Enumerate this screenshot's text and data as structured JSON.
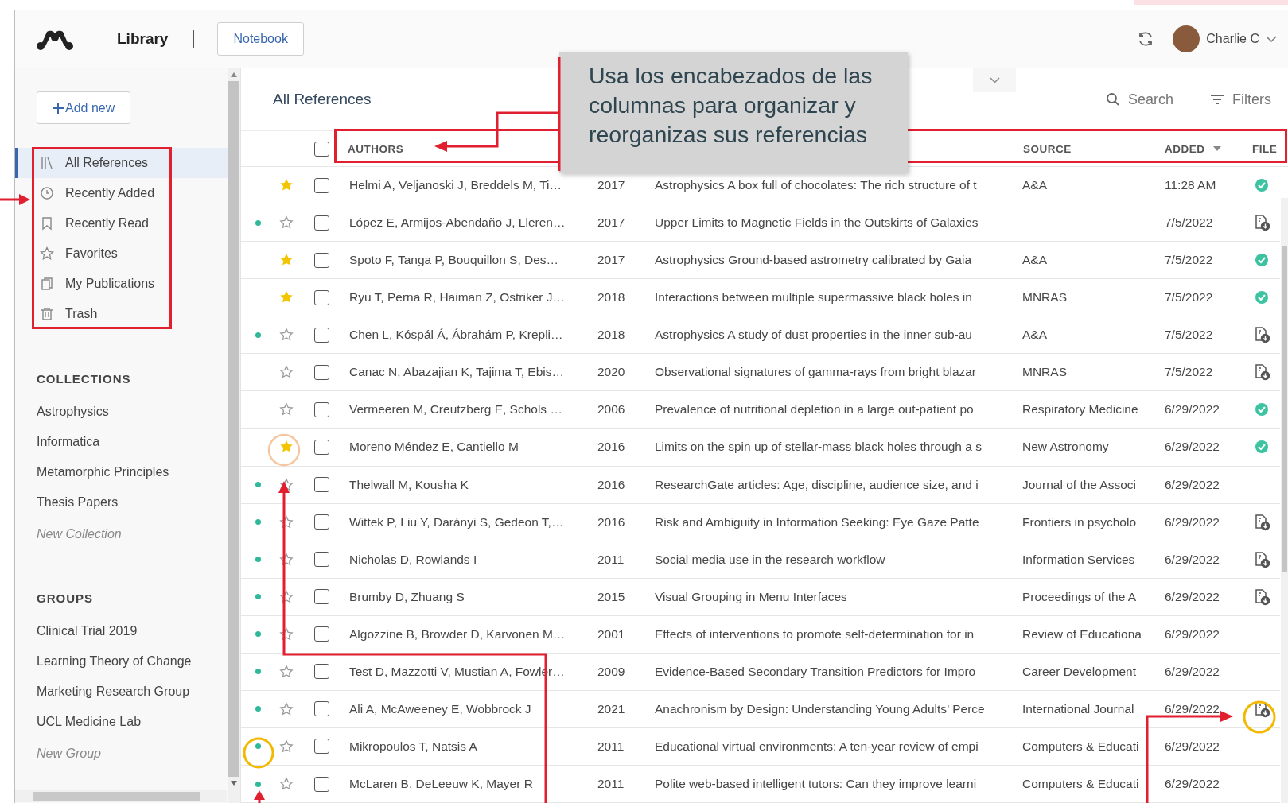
{
  "topbar": {
    "tabs": [
      {
        "label": "Library",
        "selected": true
      },
      {
        "label": "Notebook",
        "selected": false
      }
    ],
    "user": {
      "name": "Charlie C"
    }
  },
  "sidebar": {
    "add_button": "Add new",
    "items": [
      {
        "label": "All References",
        "selected": true
      },
      {
        "label": "Recently Added",
        "selected": false
      },
      {
        "label": "Recently Read",
        "selected": false
      },
      {
        "label": "Favorites",
        "selected": false
      },
      {
        "label": "My Publications",
        "selected": false
      },
      {
        "label": "Trash",
        "selected": false
      }
    ],
    "collections": {
      "title": "COLLECTIONS",
      "items": [
        {
          "label": "Astrophysics",
          "selected": false
        },
        {
          "label": "Informatica",
          "selected": false
        },
        {
          "label": "Metamorphic Principles",
          "selected": false
        },
        {
          "label": "Thesis Papers",
          "selected": false
        }
      ],
      "new_item": "New Collection"
    },
    "groups": {
      "title": "GROUPS",
      "items": [
        {
          "label": "Clinical Trial 2019",
          "selected": false
        },
        {
          "label": "Learning Theory of Change",
          "selected": false
        },
        {
          "label": "Marketing Research Group",
          "selected": false
        },
        {
          "label": "UCL Medicine Lab",
          "selected": false
        }
      ],
      "new_item": "New Group"
    }
  },
  "main": {
    "title": "All References",
    "search": "Search",
    "filters": "Filters",
    "table": {
      "all_checked": false,
      "columns": [
        {
          "label": "AUTHORS",
          "sorted": false
        },
        {
          "label": "SOURCE",
          "sorted": false
        },
        {
          "label": "ADDED",
          "sorted": true
        },
        {
          "label": "FILE",
          "sorted": false
        }
      ],
      "rows": [
        {
          "unread": false,
          "starred": true,
          "checked": false,
          "authors": "Helmi A, Veljanoski J, Breddels M, Ti…",
          "year": "2017",
          "title": "Astrophysics A box full of chocolates: The rich structure of t",
          "source": "A&A",
          "added": "11:28 AM",
          "file": {
            "downloaded": true
          }
        },
        {
          "unread": true,
          "starred": false,
          "checked": false,
          "authors": "López E, Armijos-Abendaño J, Lleren…",
          "year": "2017",
          "title": "Upper Limits to Magnetic Fields in the Outskirts of Galaxies",
          "added": "7/5/2022",
          "file": {
            "downloaded": false
          }
        },
        {
          "unread": false,
          "starred": true,
          "checked": false,
          "authors": "Spoto F, Tanga P, Bouquillon S, Des…",
          "year": "2017",
          "title": "Astrophysics Ground-based astrometry calibrated by Gaia",
          "source": "A&A",
          "added": "7/5/2022",
          "file": {
            "downloaded": true
          }
        },
        {
          "unread": false,
          "starred": true,
          "checked": false,
          "authors": "Ryu T, Perna R, Haiman Z, Ostriker J…",
          "year": "2018",
          "title": "Interactions between multiple supermassive black holes in",
          "source": "MNRAS",
          "added": "7/5/2022",
          "file": {
            "downloaded": true
          }
        },
        {
          "unread": true,
          "starred": false,
          "checked": false,
          "authors": "Chen L, Kóspál Á, Ábrahám P, Krepli…",
          "year": "2018",
          "title": "Astrophysics A study of dust properties in the inner sub-au",
          "source": "A&A",
          "added": "7/5/2022",
          "file": {
            "downloaded": false
          }
        },
        {
          "unread": false,
          "starred": false,
          "checked": false,
          "authors": "Canac N, Abazajian K, Tajima T, Ebis…",
          "year": "2020",
          "title": "Observational signatures of gamma-rays from bright blazar",
          "source": "MNRAS",
          "added": "7/5/2022",
          "file": {
            "downloaded": false
          }
        },
        {
          "unread": false,
          "starred": false,
          "checked": false,
          "authors": "Vermeeren M, Creutzberg E, Schols …",
          "year": "2006",
          "title": "Prevalence of nutritional depletion in a large out-patient po",
          "source": "Respiratory Medicine",
          "added": "6/29/2022",
          "file": {
            "downloaded": true
          }
        },
        {
          "unread": false,
          "starred": true,
          "checked": false,
          "authors": "Moreno Méndez E, Cantiello M",
          "year": "2016",
          "title": "Limits on the spin up of stellar-mass black holes through a s",
          "source": "New Astronomy",
          "added": "6/29/2022",
          "file": {
            "downloaded": true
          }
        },
        {
          "unread": true,
          "starred": false,
          "checked": false,
          "authors": "Thelwall M, Kousha K",
          "year": "2016",
          "title": "ResearchGate articles: Age, discipline, audience size, and i",
          "source": "Journal of the Associ",
          "added": "6/29/2022"
        },
        {
          "unread": true,
          "starred": false,
          "checked": false,
          "authors": "Wittek P, Liu Y, Darányi S, Gedeon T,…",
          "year": "2016",
          "title": "Risk and Ambiguity in Information Seeking: Eye Gaze Patte",
          "source": "Frontiers in psycholo",
          "added": "6/29/2022",
          "file": {
            "downloaded": false
          }
        },
        {
          "unread": true,
          "starred": false,
          "checked": false,
          "authors": "Nicholas D, Rowlands I",
          "year": "2011",
          "title": "Social media use in the research workflow",
          "source": "Information Services",
          "added": "6/29/2022",
          "file": {
            "downloaded": false
          }
        },
        {
          "unread": true,
          "starred": false,
          "checked": false,
          "authors": "Brumby D, Zhuang S",
          "year": "2015",
          "title": "Visual Grouping in Menu Interfaces",
          "source": "Proceedings of the A",
          "added": "6/29/2022",
          "file": {
            "downloaded": false
          }
        },
        {
          "unread": true,
          "starred": false,
          "checked": false,
          "authors": "Algozzine B, Browder D, Karvonen M…",
          "year": "2001",
          "title": "Effects of interventions to promote self-determination for in",
          "source": "Review of Educationa",
          "added": "6/29/2022"
        },
        {
          "unread": true,
          "starred": false,
          "checked": false,
          "authors": "Test D, Mazzotti V, Mustian A, Fowler…",
          "year": "2009",
          "title": "Evidence-Based Secondary Transition Predictors for Impro",
          "source": "Career Development",
          "added": "6/29/2022"
        },
        {
          "unread": true,
          "starred": false,
          "checked": false,
          "authors": "Ali A, McAweeney E, Wobbrock J",
          "year": "2021",
          "title": "Anachronism by Design: Understanding Young Adults’ Perce",
          "source": "International Journal",
          "added": "6/29/2022",
          "file": {
            "downloaded": false
          }
        },
        {
          "unread": true,
          "starred": false,
          "checked": false,
          "authors": "Mikropoulos T, Natsis A",
          "year": "2011",
          "title": "Educational virtual environments: A ten-year review of empi",
          "source": "Computers & Educati",
          "added": "6/29/2022"
        },
        {
          "unread": true,
          "starred": false,
          "checked": false,
          "authors": "McLaren B, DeLeeuw K, Mayer R",
          "year": "2011",
          "title": "Polite web-based intelligent tutors: Can they improve learni",
          "source": "Computers & Educati",
          "added": "6/29/2022"
        }
      ]
    }
  },
  "annotation": {
    "callout": "Usa los encabezados de las columnas para organizar y reorganizas sus referencias"
  }
}
